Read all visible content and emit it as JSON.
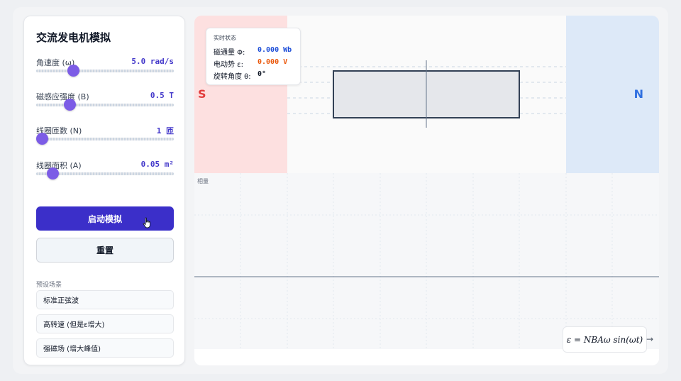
{
  "sidebar": {
    "title": "交流发电机模拟",
    "controls": [
      {
        "label": "角速度 (ω)",
        "value": "5.0 rad/s",
        "fraction": 0.27
      },
      {
        "label": "磁感应强度 (B)",
        "value": "0.5 T",
        "fraction": 0.24
      },
      {
        "label": "线圈匝数 (N)",
        "value": "1 匝",
        "fraction": 0.04
      },
      {
        "label": "线圈面积 (A)",
        "value": "0.05 m²",
        "fraction": 0.12
      }
    ],
    "start_label": "启动模拟",
    "reset_label": "重置",
    "presets_title": "预设场景",
    "presets": [
      "标准正弦波",
      "高转速 (但是ε增大)",
      "强磁场 (增大峰值)"
    ]
  },
  "main": {
    "pole_s": "S",
    "pole_n": "N",
    "status": {
      "title": "实时状态",
      "flux_label": "磁通量 Φ:",
      "flux_value": "0.000 Wb",
      "emf_label": "电动势 ε:",
      "emf_value": "0.000 V",
      "angle_label": "旋转角度 θ:",
      "angle_value": "0°"
    },
    "chart_label": "相量",
    "formula": "ε = NBAω sin(ωt)",
    "formula_arrow": "→"
  },
  "colors": {
    "accent": "#3b2fc9",
    "slider_thumb": "#7c5ce6",
    "flux": "#1d4ed8",
    "emf": "#ea580c",
    "south": "#e23b3b",
    "north": "#2f6fe0"
  },
  "icons": [
    "hand-pointer-icon"
  ]
}
